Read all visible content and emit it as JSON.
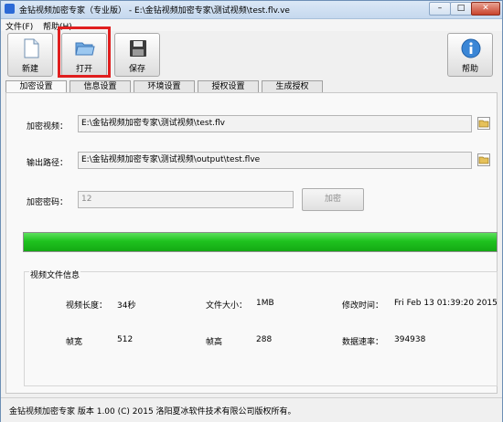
{
  "window": {
    "title": "金钻视频加密专家（专业版） - E:\\金钻视频加密专家\\测试视频\\test.flv.ve",
    "minimize": "–",
    "maximize": "□",
    "close": "✕"
  },
  "menu": [
    "文件(F)",
    "帮助(H)"
  ],
  "toolbar": {
    "new": "新建",
    "open": "打开",
    "save": "保存",
    "help": "帮助"
  },
  "tabs": [
    "加密设置",
    "信息设置",
    "环境设置",
    "授权设置",
    "生成授权"
  ],
  "form": {
    "video_label": "加密视频：",
    "video_value": "E:\\金钻视频加密专家\\测试视频\\test.flv",
    "output_label": "输出路径：",
    "output_value": "E:\\金钻视频加密专家\\测试视频\\output\\test.flve",
    "password_label": "加密密码：",
    "password_value": "12",
    "encrypt_button": "加密"
  },
  "progress": {
    "percent": 100,
    "color": "#1fc21f"
  },
  "info": {
    "group_title": "视频文件信息",
    "duration_label": "视频长度：",
    "duration_value": "34秒",
    "size_label": "文件大小：",
    "size_value": "1MB",
    "mtime_label": "修改时间：",
    "mtime_value": "Fri Feb 13 01:39:20 2015",
    "width_label": "帧宽",
    "width_value": "512",
    "height_label": "帧高",
    "height_value": "288",
    "bitrate_label": "数据速率：",
    "bitrate_value": "394938"
  },
  "status": "金钻视频加密专家  版本 1.00 (C)  2015 洛阳夏冰软件技术有限公司版权所有。"
}
